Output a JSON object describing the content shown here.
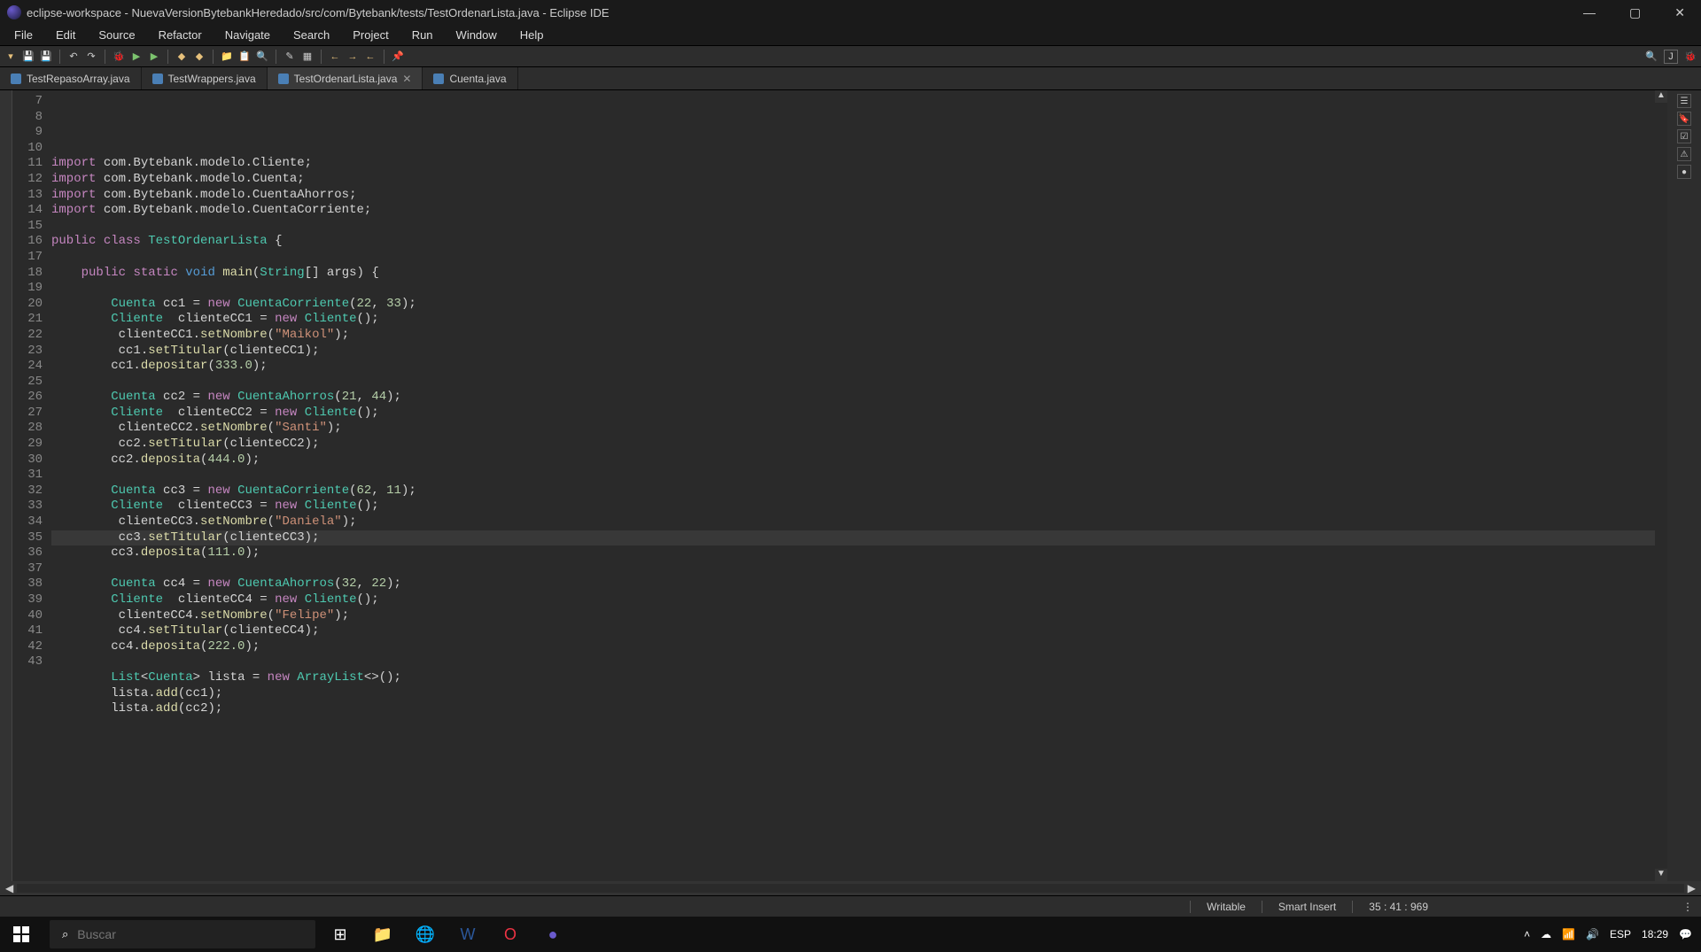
{
  "title": "eclipse-workspace - NuevaVersionBytebankHeredado/src/com/Bytebank/tests/TestOrdenarLista.java - Eclipse IDE",
  "menus": [
    "File",
    "Edit",
    "Source",
    "Refactor",
    "Navigate",
    "Search",
    "Project",
    "Run",
    "Window",
    "Help"
  ],
  "tabs": [
    {
      "label": "TestRepasoArray.java",
      "active": false
    },
    {
      "label": "TestWrappers.java",
      "active": false
    },
    {
      "label": "TestOrdenarLista.java",
      "active": true,
      "closeable": true
    },
    {
      "label": "Cuenta.java",
      "active": false
    }
  ],
  "lines_start": 7,
  "lines_end": 43,
  "highlighted_line": 35,
  "code": {
    "l8": {
      "pre": "",
      "tokens": [
        [
          "kw",
          "import"
        ],
        [
          "plain",
          " com.Bytebank.modelo.Cliente;"
        ]
      ]
    },
    "l9": {
      "pre": "",
      "tokens": [
        [
          "kw",
          "import"
        ],
        [
          "plain",
          " com.Bytebank.modelo.Cuenta;"
        ]
      ]
    },
    "l10": {
      "pre": "",
      "tokens": [
        [
          "kw",
          "import"
        ],
        [
          "plain",
          " com.Bytebank.modelo.CuentaAhorros;"
        ]
      ]
    },
    "l11": {
      "pre": "",
      "tokens": [
        [
          "kw",
          "import"
        ],
        [
          "plain",
          " com.Bytebank.modelo.CuentaCorriente;"
        ]
      ]
    },
    "l13": {
      "pre": "",
      "tokens": [
        [
          "kw",
          "public"
        ],
        [
          "plain",
          " "
        ],
        [
          "kw",
          "class"
        ],
        [
          "plain",
          " "
        ],
        [
          "cls",
          "TestOrdenarLista"
        ],
        [
          "plain",
          " {"
        ]
      ]
    },
    "l15": {
      "pre": "    ",
      "tokens": [
        [
          "kw",
          "public"
        ],
        [
          "plain",
          " "
        ],
        [
          "kw",
          "static"
        ],
        [
          "plain",
          " "
        ],
        [
          "type",
          "void"
        ],
        [
          "plain",
          " "
        ],
        [
          "fn",
          "main"
        ],
        [
          "plain",
          "("
        ],
        [
          "cls",
          "String"
        ],
        [
          "plain",
          "[] args) {"
        ]
      ]
    },
    "l17": {
      "pre": "        ",
      "tokens": [
        [
          "cls",
          "Cuenta"
        ],
        [
          "plain",
          " cc1 = "
        ],
        [
          "kw",
          "new"
        ],
        [
          "plain",
          " "
        ],
        [
          "cls",
          "CuentaCorriente"
        ],
        [
          "plain",
          "("
        ],
        [
          "num",
          "22"
        ],
        [
          "plain",
          ", "
        ],
        [
          "num",
          "33"
        ],
        [
          "plain",
          ");"
        ]
      ]
    },
    "l18": {
      "pre": "        ",
      "tokens": [
        [
          "cls",
          "Cliente"
        ],
        [
          "plain",
          "  clienteCC1 = "
        ],
        [
          "kw",
          "new"
        ],
        [
          "plain",
          " "
        ],
        [
          "cls",
          "Cliente"
        ],
        [
          "plain",
          "();"
        ]
      ]
    },
    "l19": {
      "pre": "         ",
      "tokens": [
        [
          "plain",
          "clienteCC1."
        ],
        [
          "fn",
          "setNombre"
        ],
        [
          "plain",
          "("
        ],
        [
          "str",
          "\"Maikol\""
        ],
        [
          "plain",
          ");"
        ]
      ]
    },
    "l20": {
      "pre": "         ",
      "tokens": [
        [
          "plain",
          "cc1."
        ],
        [
          "fn",
          "setTitular"
        ],
        [
          "plain",
          "(clienteCC1);"
        ]
      ]
    },
    "l21": {
      "pre": "        ",
      "tokens": [
        [
          "plain",
          "cc1."
        ],
        [
          "fn",
          "depositar"
        ],
        [
          "plain",
          "("
        ],
        [
          "num",
          "333.0"
        ],
        [
          "plain",
          ");"
        ]
      ]
    },
    "l23": {
      "pre": "        ",
      "tokens": [
        [
          "cls",
          "Cuenta"
        ],
        [
          "plain",
          " cc2 = "
        ],
        [
          "kw",
          "new"
        ],
        [
          "plain",
          " "
        ],
        [
          "cls",
          "CuentaAhorros"
        ],
        [
          "plain",
          "("
        ],
        [
          "num",
          "21"
        ],
        [
          "plain",
          ", "
        ],
        [
          "num",
          "44"
        ],
        [
          "plain",
          ");"
        ]
      ]
    },
    "l24": {
      "pre": "        ",
      "tokens": [
        [
          "cls",
          "Cliente"
        ],
        [
          "plain",
          "  clienteCC2 = "
        ],
        [
          "kw",
          "new"
        ],
        [
          "plain",
          " "
        ],
        [
          "cls",
          "Cliente"
        ],
        [
          "plain",
          "();"
        ]
      ]
    },
    "l25": {
      "pre": "         ",
      "tokens": [
        [
          "plain",
          "clienteCC2."
        ],
        [
          "fn",
          "setNombre"
        ],
        [
          "plain",
          "("
        ],
        [
          "str",
          "\"Santi\""
        ],
        [
          "plain",
          ");"
        ]
      ]
    },
    "l26": {
      "pre": "         ",
      "tokens": [
        [
          "plain",
          "cc2."
        ],
        [
          "fn",
          "setTitular"
        ],
        [
          "plain",
          "(clienteCC2);"
        ]
      ]
    },
    "l27": {
      "pre": "        ",
      "tokens": [
        [
          "plain",
          "cc2."
        ],
        [
          "fn",
          "deposita"
        ],
        [
          "plain",
          "("
        ],
        [
          "num",
          "444.0"
        ],
        [
          "plain",
          ");"
        ]
      ]
    },
    "l29": {
      "pre": "        ",
      "tokens": [
        [
          "cls",
          "Cuenta"
        ],
        [
          "plain",
          " cc3 = "
        ],
        [
          "kw",
          "new"
        ],
        [
          "plain",
          " "
        ],
        [
          "cls",
          "CuentaCorriente"
        ],
        [
          "plain",
          "("
        ],
        [
          "num",
          "62"
        ],
        [
          "plain",
          ", "
        ],
        [
          "num",
          "11"
        ],
        [
          "plain",
          ");"
        ]
      ]
    },
    "l30": {
      "pre": "        ",
      "tokens": [
        [
          "cls",
          "Cliente"
        ],
        [
          "plain",
          "  clienteCC3 = "
        ],
        [
          "kw",
          "new"
        ],
        [
          "plain",
          " "
        ],
        [
          "cls",
          "Cliente"
        ],
        [
          "plain",
          "();"
        ]
      ]
    },
    "l31": {
      "pre": "         ",
      "tokens": [
        [
          "plain",
          "clienteCC3."
        ],
        [
          "fn",
          "setNombre"
        ],
        [
          "plain",
          "("
        ],
        [
          "str",
          "\"Daniela\""
        ],
        [
          "plain",
          ");"
        ]
      ]
    },
    "l32": {
      "pre": "         ",
      "tokens": [
        [
          "plain",
          "cc3."
        ],
        [
          "fn",
          "setTitular"
        ],
        [
          "plain",
          "(clienteCC3);"
        ]
      ]
    },
    "l33": {
      "pre": "        ",
      "tokens": [
        [
          "plain",
          "cc3."
        ],
        [
          "fn",
          "deposita"
        ],
        [
          "plain",
          "("
        ],
        [
          "num",
          "111.0"
        ],
        [
          "plain",
          ");"
        ]
      ]
    },
    "l35": {
      "pre": "        ",
      "tokens": [
        [
          "cls",
          "Cuenta"
        ],
        [
          "plain",
          " cc4 = "
        ],
        [
          "kw",
          "new"
        ],
        [
          "plain",
          " "
        ],
        [
          "cls",
          "CuentaAhorros"
        ],
        [
          "plain",
          "("
        ],
        [
          "num",
          "32"
        ],
        [
          "plain",
          ", "
        ],
        [
          "num",
          "22"
        ],
        [
          "plain",
          ");"
        ]
      ]
    },
    "l36": {
      "pre": "        ",
      "tokens": [
        [
          "cls",
          "Cliente"
        ],
        [
          "plain",
          "  clienteCC4 = "
        ],
        [
          "kw",
          "new"
        ],
        [
          "plain",
          " "
        ],
        [
          "cls",
          "Cliente"
        ],
        [
          "plain",
          "();"
        ]
      ]
    },
    "l37": {
      "pre": "         ",
      "tokens": [
        [
          "plain",
          "clienteCC4."
        ],
        [
          "fn",
          "setNombre"
        ],
        [
          "plain",
          "("
        ],
        [
          "str",
          "\"Felipe\""
        ],
        [
          "plain",
          ");"
        ]
      ]
    },
    "l38": {
      "pre": "         ",
      "tokens": [
        [
          "plain",
          "cc4."
        ],
        [
          "fn",
          "setTitular"
        ],
        [
          "plain",
          "(clienteCC4);"
        ]
      ]
    },
    "l39": {
      "pre": "        ",
      "tokens": [
        [
          "plain",
          "cc4."
        ],
        [
          "fn",
          "deposita"
        ],
        [
          "plain",
          "("
        ],
        [
          "num",
          "222.0"
        ],
        [
          "plain",
          ");"
        ]
      ]
    },
    "l41": {
      "pre": "        ",
      "tokens": [
        [
          "cls",
          "List"
        ],
        [
          "plain",
          "<"
        ],
        [
          "cls",
          "Cuenta"
        ],
        [
          "plain",
          "> lista = "
        ],
        [
          "kw",
          "new"
        ],
        [
          "plain",
          " "
        ],
        [
          "cls",
          "ArrayList"
        ],
        [
          "plain",
          "<>();"
        ]
      ]
    },
    "l42": {
      "pre": "        ",
      "tokens": [
        [
          "plain",
          "lista."
        ],
        [
          "fn",
          "add"
        ],
        [
          "plain",
          "(cc1);"
        ]
      ]
    },
    "l43": {
      "pre": "        ",
      "tokens": [
        [
          "plain",
          "lista."
        ],
        [
          "fn",
          "add"
        ],
        [
          "plain",
          "(cc2);"
        ]
      ]
    }
  },
  "status": {
    "writable": "Writable",
    "insert": "Smart Insert",
    "pos": "35 : 41 : 969"
  },
  "search_placeholder": "Buscar",
  "clock": "18:29",
  "lang": "ESP"
}
